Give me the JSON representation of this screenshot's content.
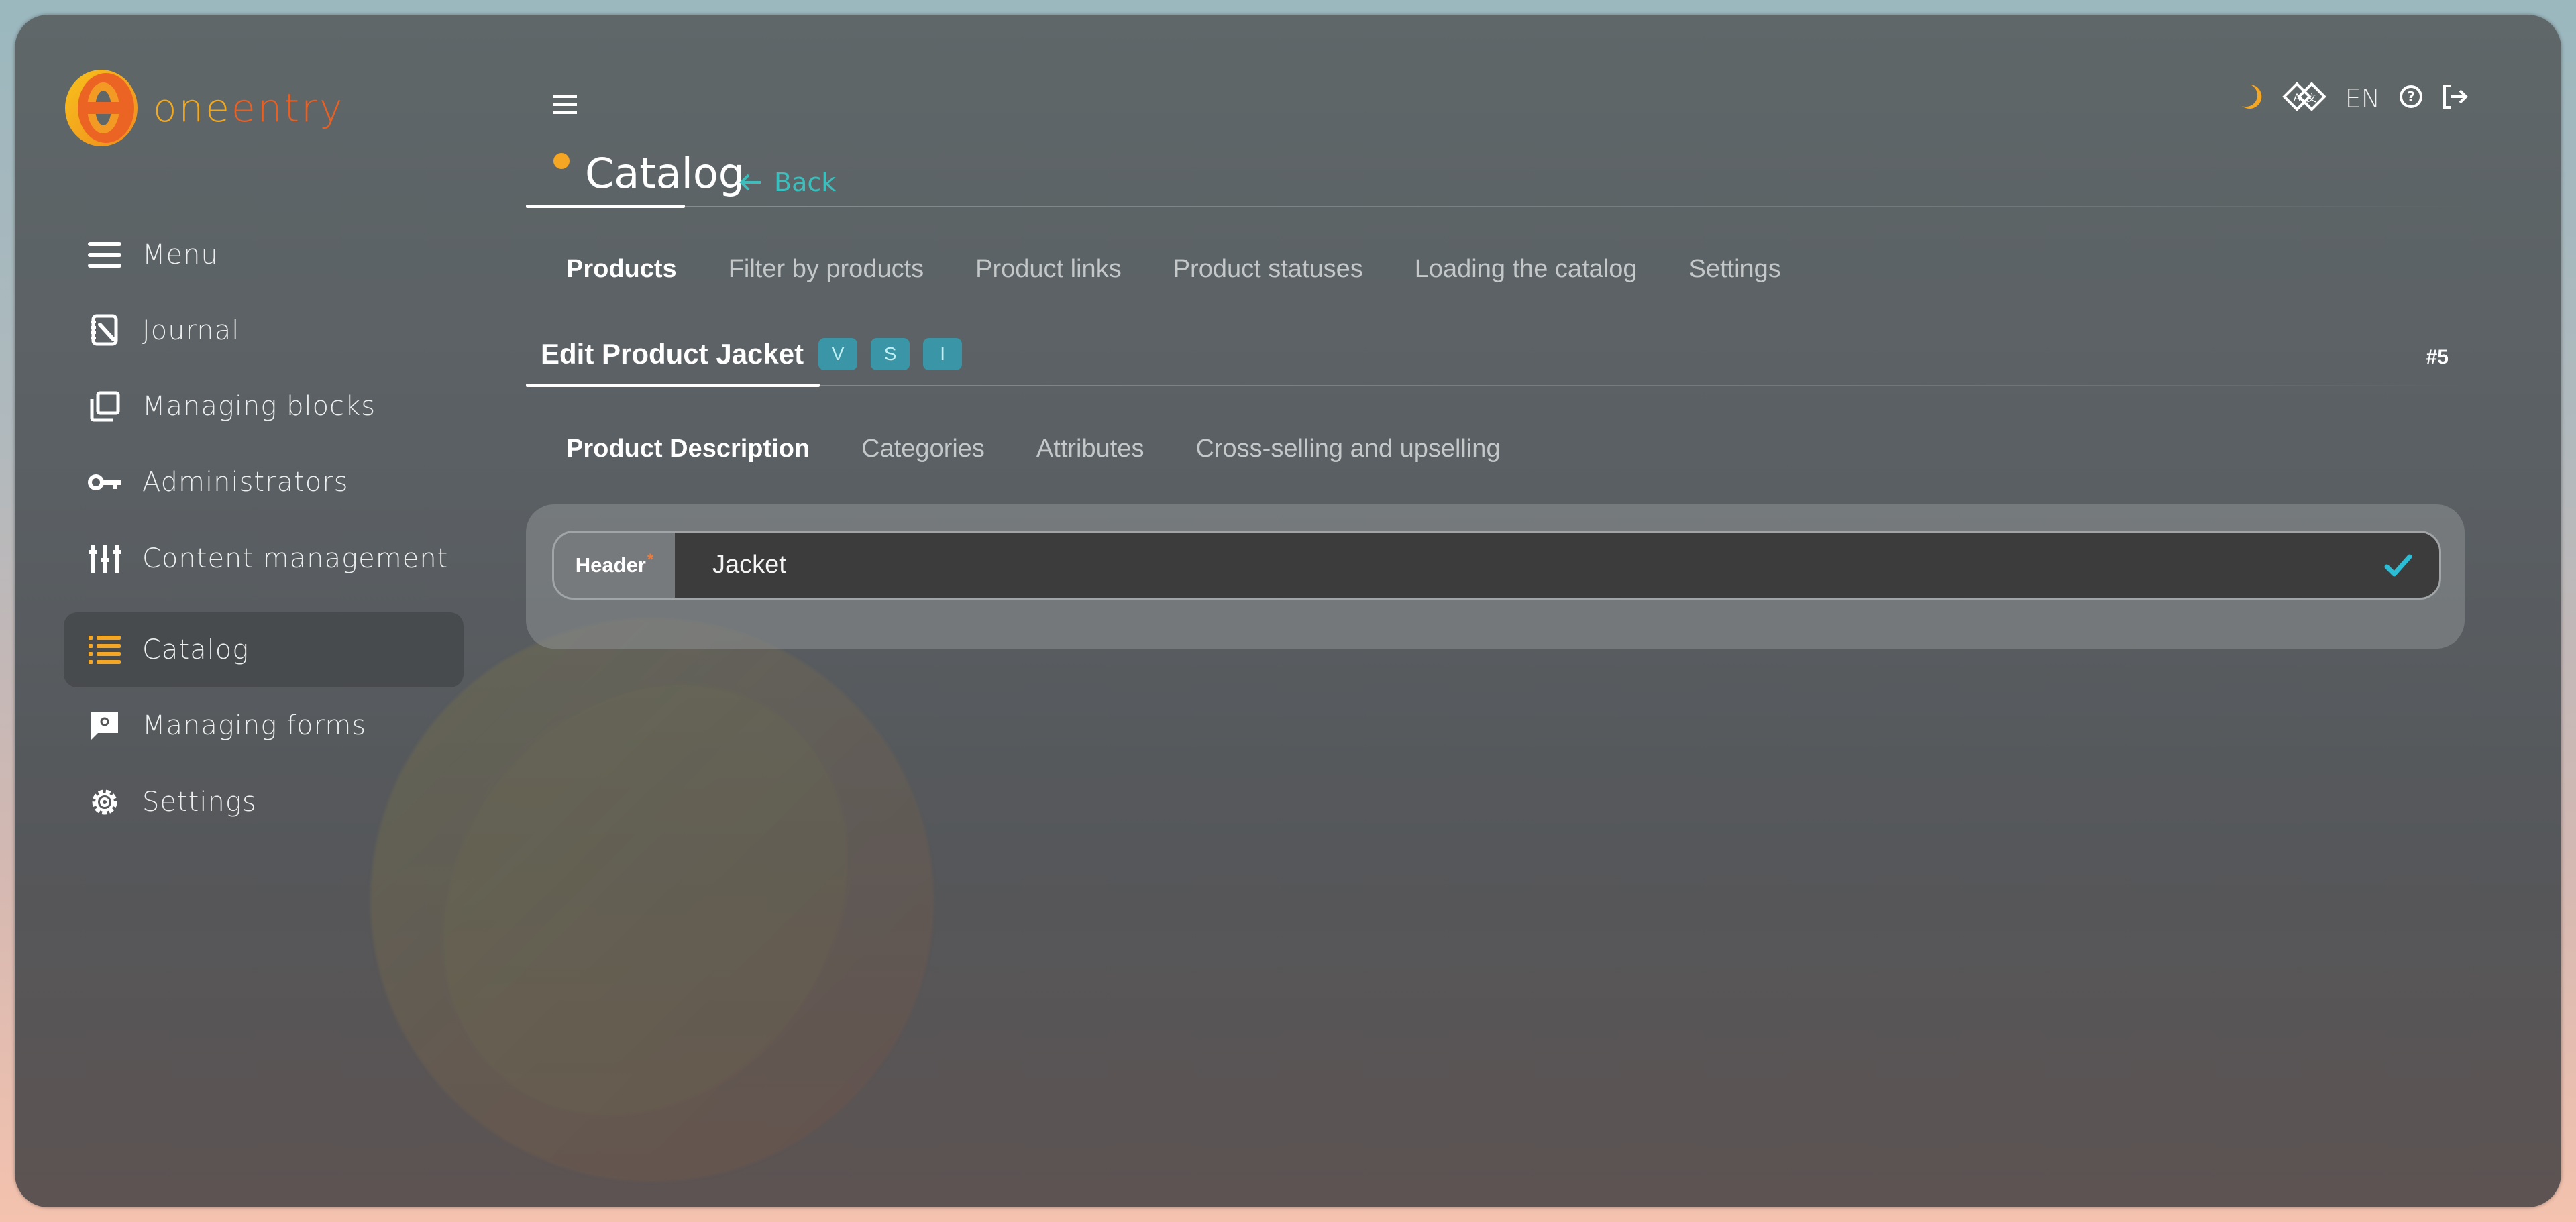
{
  "brand": {
    "logo_one": "one",
    "logo_entry": "entry",
    "accent": "#f5a623",
    "link_color": "#3dbdbb"
  },
  "sidebar": {
    "items": [
      {
        "label": "Menu",
        "icon": "menu-icon",
        "active": false
      },
      {
        "label": "Journal",
        "icon": "journal-icon",
        "active": false
      },
      {
        "label": "Managing blocks",
        "icon": "blocks-icon",
        "active": false
      },
      {
        "label": "Administrators",
        "icon": "key-icon",
        "active": false
      },
      {
        "label": "Content management",
        "icon": "sliders-icon",
        "active": false
      },
      {
        "label": "Catalog",
        "icon": "list-icon",
        "active": true
      },
      {
        "label": "Managing forms",
        "icon": "form-icon",
        "active": false
      },
      {
        "label": "Settings",
        "icon": "gear-icon",
        "active": false
      }
    ]
  },
  "topbar": {
    "language": "EN",
    "icons": [
      "moon-icon",
      "translate-icon",
      "help-icon",
      "logout-icon"
    ]
  },
  "page": {
    "title": "Catalog",
    "back_label": "Back",
    "tabs": [
      {
        "label": "Products",
        "active": true
      },
      {
        "label": "Filter by products",
        "active": false
      },
      {
        "label": "Product links",
        "active": false
      },
      {
        "label": "Product statuses",
        "active": false
      },
      {
        "label": "Loading the catalog",
        "active": false
      },
      {
        "label": "Settings",
        "active": false
      }
    ]
  },
  "editor": {
    "title": "Edit Product Jacket",
    "badges": [
      "V",
      "S",
      "I"
    ],
    "record_id": "#5",
    "subtabs": [
      {
        "label": "Product Description",
        "active": true
      },
      {
        "label": "Categories",
        "active": false
      },
      {
        "label": "Attributes",
        "active": false
      },
      {
        "label": "Cross-selling and upselling",
        "active": false
      }
    ],
    "fields": {
      "header": {
        "label": "Header",
        "required_mark": "*",
        "value": "Jacket",
        "valid": true
      }
    }
  }
}
